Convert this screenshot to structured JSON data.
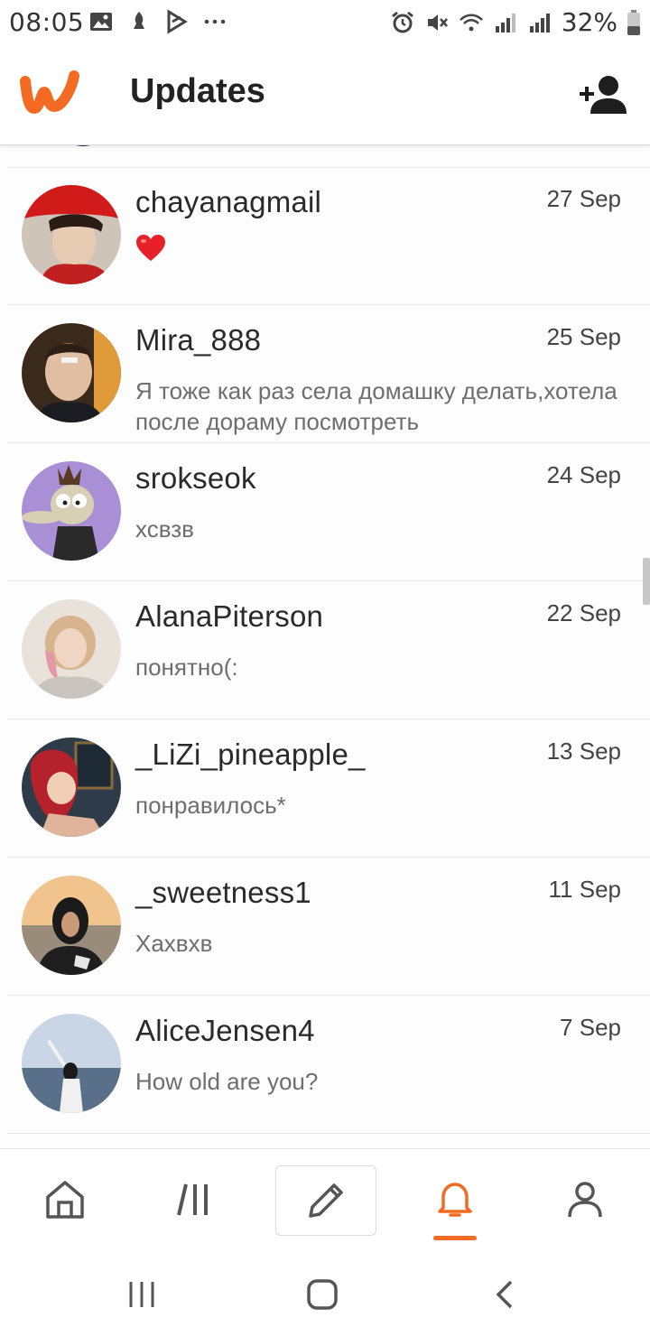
{
  "status_bar": {
    "time": "08:05",
    "battery": "32%",
    "left_icons": [
      "gallery-icon",
      "notification-icon",
      "play-store-icon",
      "more-dots-icon"
    ],
    "right_icons": [
      "alarm-icon",
      "mute-icon",
      "wifi-icon",
      "signal-icon",
      "signal-icon",
      "battery-icon"
    ]
  },
  "header": {
    "title": "Updates",
    "logo_icon": "wattpad-logo-icon",
    "action_icon": "add-friend-icon",
    "brand_color": "#f36b22"
  },
  "conversations": [
    {
      "username": "chayanagmail",
      "date": "27 Sep",
      "message": "❤️",
      "message_is_emoji": true
    },
    {
      "username": "Mira_888",
      "date": "25 Sep",
      "message": "Я тоже как раз села домашку делать,хотела после дораму посмотреть"
    },
    {
      "username": "srokseok",
      "date": "24 Sep",
      "message": "хсвзв"
    },
    {
      "username": "AlanaPiterson",
      "date": "22 Sep",
      "message": "понятно(:"
    },
    {
      "username": "_LiZi_pineapple_",
      "date": "13 Sep",
      "message": "понравилось*"
    },
    {
      "username": "_sweetness1",
      "date": "11 Sep",
      "message": "Хахвхв"
    },
    {
      "username": "AliceJensen4",
      "date": "7 Sep",
      "message": "How old are you?"
    }
  ],
  "bottom_nav": {
    "items": [
      "home-icon",
      "library-icon",
      "write-icon",
      "notifications-icon",
      "profile-icon"
    ],
    "active": "notifications-icon"
  },
  "system_nav": [
    "recent-apps-icon",
    "home-button-icon",
    "back-icon"
  ]
}
